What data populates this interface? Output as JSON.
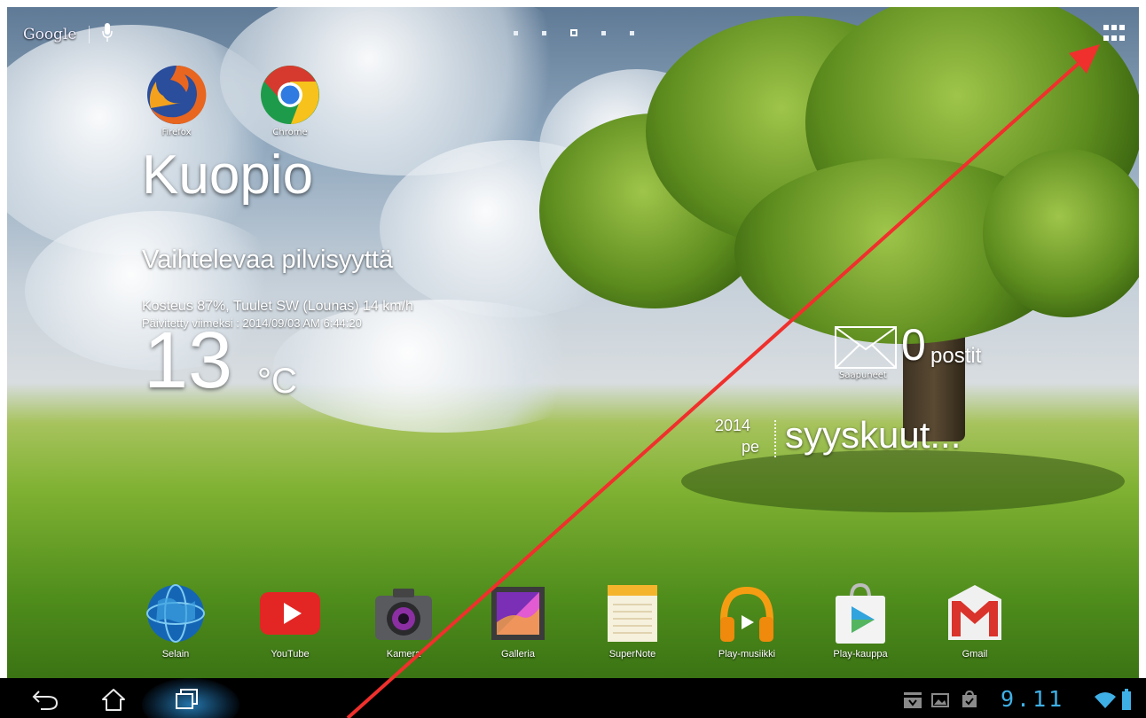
{
  "search": {
    "logo_text": "Google"
  },
  "top_shortcuts": [
    {
      "label": "Firefox",
      "icon": "firefox-icon"
    },
    {
      "label": "Chrome",
      "icon": "chrome-icon"
    }
  ],
  "weather": {
    "city": "Kuopio",
    "condition": "Vaihtelevaa pilvisyyttä",
    "details": "Kosteus 87%, Tuulet SW (Lounas) 14 km/h",
    "updated": "Päivitetty viimeksi : 2014/09/03 AM 6:44:20",
    "temperature": "13",
    "unit": "°C"
  },
  "email": {
    "label": "Saapuneet",
    "count": "0",
    "word": "postit"
  },
  "calendar": {
    "year": "2014",
    "day": "pe",
    "month": "syyskuut..."
  },
  "dock": [
    {
      "label": "Selain",
      "icon": "globe-icon"
    },
    {
      "label": "YouTube",
      "icon": "youtube-icon"
    },
    {
      "label": "Kamera",
      "icon": "camera-icon"
    },
    {
      "label": "Galleria",
      "icon": "gallery-icon"
    },
    {
      "label": "SuperNote",
      "icon": "notepad-icon"
    },
    {
      "label": "Play-musiikki",
      "icon": "headphones-icon"
    },
    {
      "label": "Play-kauppa",
      "icon": "shopping-bag-icon"
    },
    {
      "label": "Gmail",
      "icon": "gmail-icon"
    }
  ],
  "status": {
    "time": "9.11",
    "accent_color": "#3fb0e6"
  },
  "annotation": {
    "arrow_color": "#f0302c"
  }
}
